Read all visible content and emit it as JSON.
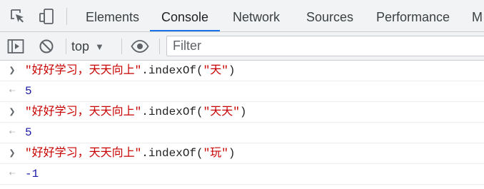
{
  "tabs": [
    {
      "label": "Elements"
    },
    {
      "label": "Console"
    },
    {
      "label": "Network"
    },
    {
      "label": "Sources"
    },
    {
      "label": "Performance"
    },
    {
      "label": "M"
    }
  ],
  "toolbar": {
    "context": "top",
    "filter_placeholder": "Filter"
  },
  "console": {
    "entries": [
      {
        "str": "\"好好学习，天天向上\"",
        "method": ".indexOf(",
        "arg": "\"天\"",
        "close": ")",
        "result": "5"
      },
      {
        "str": "\"好好学习，天天向上\"",
        "method": ".indexOf(",
        "arg": "\"天天\"",
        "close": ")",
        "result": "5"
      },
      {
        "str": "\"好好学习，天天向上\"",
        "method": ".indexOf(",
        "arg": "\"玩\"",
        "close": ")",
        "result": "-1"
      }
    ]
  },
  "icons": {
    "inspect": "inspect-element-icon",
    "device": "device-toolbar-icon",
    "sidebar": "show-sidebar-icon",
    "clear": "clear-console-icon",
    "eye": "live-expression-icon",
    "input_prompt": "input-chevron-icon",
    "output_prompt": "output-arrow-icon"
  },
  "colors": {
    "active_tab_underline": "#1a73e8",
    "string": "#c80000",
    "number": "#1a1aa6"
  }
}
